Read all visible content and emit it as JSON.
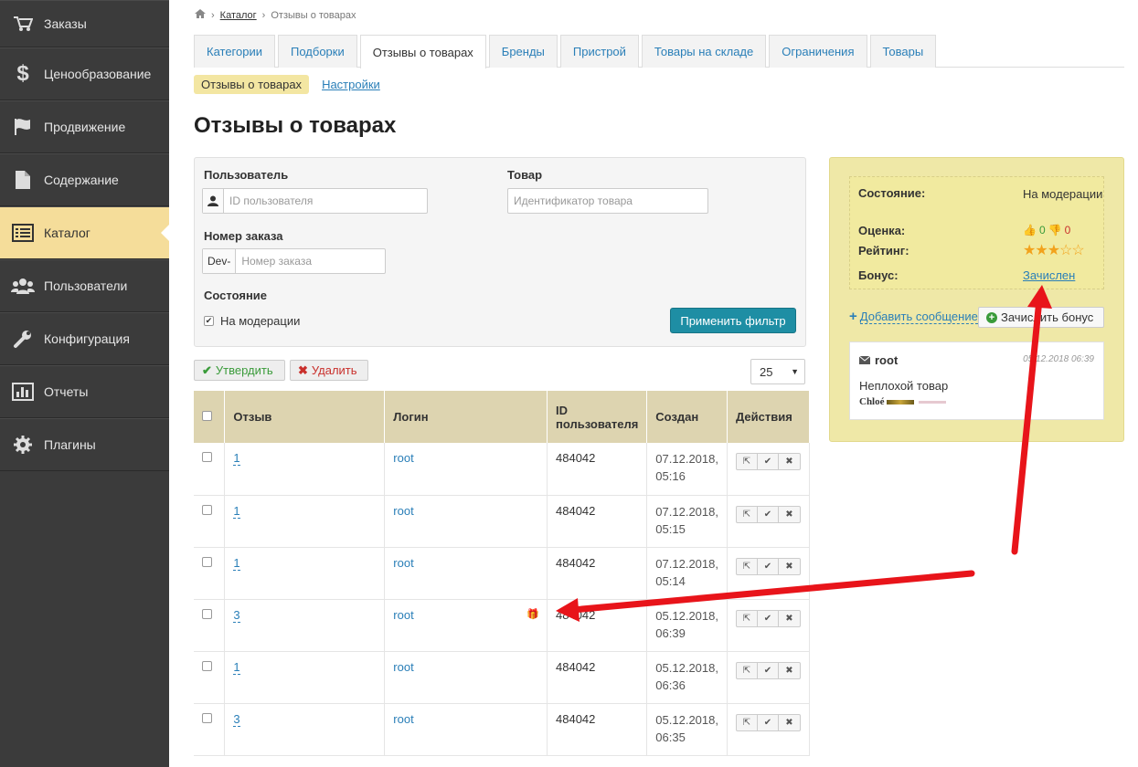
{
  "sidebar": {
    "items": [
      {
        "label": "Заказы",
        "icon": "cart-icon"
      },
      {
        "label": "Ценообразование",
        "icon": "dollar-icon"
      },
      {
        "label": "Продвижение",
        "icon": "flag-icon"
      },
      {
        "label": "Содержание",
        "icon": "document-icon"
      },
      {
        "label": "Каталог",
        "icon": "list-icon"
      },
      {
        "label": "Пользователи",
        "icon": "users-icon"
      },
      {
        "label": "Конфигурация",
        "icon": "wrench-icon"
      },
      {
        "label": "Отчеты",
        "icon": "bar-chart-icon"
      },
      {
        "label": "Плагины",
        "icon": "gear-icon"
      }
    ],
    "active": "Каталог"
  },
  "breadcrumb": {
    "link": "Каталог",
    "current": "Отзывы о товарах"
  },
  "tabs": [
    "Категории",
    "Подборки",
    "Отзывы о товарах",
    "Бренды",
    "Пристрой",
    "Товары на складе",
    "Ограничения",
    "Товары"
  ],
  "subtabs": {
    "active": "Отзывы о товарах",
    "link": "Настройки"
  },
  "page_title": "Отзывы о товарах",
  "filter": {
    "user_label": "Пользователь",
    "user_placeholder": "ID пользователя",
    "product_label": "Товар",
    "product_placeholder": "Идентификатор товара",
    "order_label": "Номер заказа",
    "order_prefix": "Dev-",
    "order_placeholder": "Номер заказа",
    "state_label": "Состояние",
    "state_option": "На модерации",
    "apply_button": "Применить фильтр"
  },
  "toolbar": {
    "approve": "Утвердить",
    "delete": "Удалить",
    "page_size": "25"
  },
  "table": {
    "headers": [
      "Отзыв",
      "Логин",
      "ID пользователя",
      "Создан",
      "Действия"
    ],
    "rows": [
      {
        "review": "1",
        "login": "root",
        "user_id": "484042",
        "date": "07.12.2018,",
        "time": "05:16"
      },
      {
        "review": "1",
        "login": "root",
        "user_id": "484042",
        "date": "07.12.2018,",
        "time": "05:15"
      },
      {
        "review": "1",
        "login": "root",
        "user_id": "484042",
        "date": "07.12.2018,",
        "time": "05:14"
      },
      {
        "review": "3",
        "login": "root",
        "user_id": "484042",
        "date": "05.12.2018,",
        "time": "06:39"
      },
      {
        "review": "1",
        "login": "root",
        "user_id": "484042",
        "date": "05.12.2018,",
        "time": "06:36"
      },
      {
        "review": "3",
        "login": "root",
        "user_id": "484042",
        "date": "05.12.2018,",
        "time": "06:35"
      }
    ]
  },
  "details": {
    "state_key": "Состояние:",
    "state_value": "На модерации",
    "score_key": "Оценка:",
    "likes": "0",
    "dislikes": "0",
    "rating_key": "Рейтинг:",
    "rating": 3,
    "rating_max": 5,
    "bonus_key": "Бонус:",
    "bonus_value": "Зачислен",
    "add_message": "Добавить сообщение",
    "credit_bonus": "Зачислить бонус",
    "message_author": "root",
    "message_date": "05.12.2018 06:39",
    "message_text": "Неплохой товар",
    "message_brand": "Chloé"
  },
  "colors": {
    "sidebar_bg": "#3b3b3b",
    "active_nav": "#f5dd9a",
    "panel_bg": "#efe8a7",
    "primary": "#1e8ea4",
    "link": "#2a7fb8",
    "arrow": "#e8141a"
  }
}
